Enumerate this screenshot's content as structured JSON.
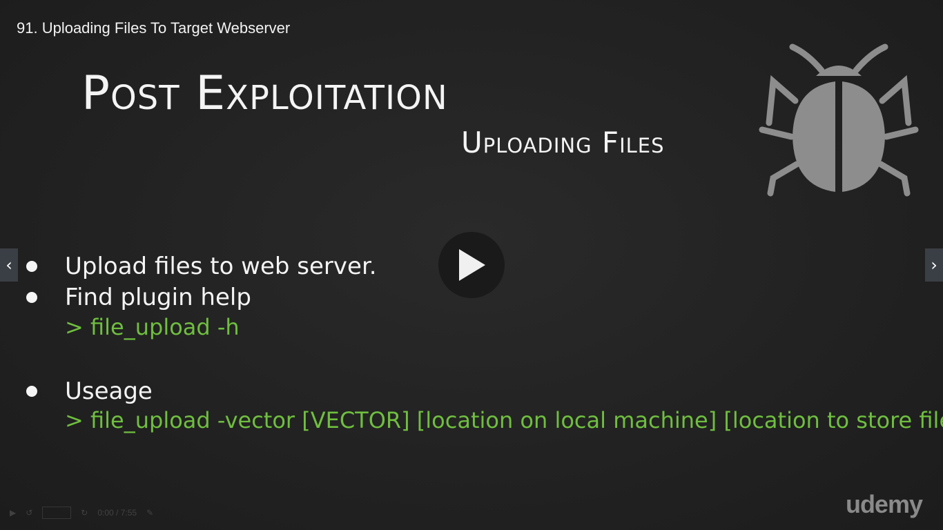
{
  "lecture": {
    "title": "91. Uploading Files To Target Webserver"
  },
  "slide": {
    "title": "Post Exploitation",
    "subtitle": "Uploading Files",
    "bullets": [
      {
        "text": "Upload files to web server."
      },
      {
        "text": "Find plugin help",
        "command": "> file_upload -h"
      },
      {
        "text": "Useage",
        "command": "> file_upload -vector [VECTOR] [location on local machine] [location to store file]"
      }
    ]
  },
  "player": {
    "prev_icon": "chevron-left-icon",
    "next_icon": "chevron-right-icon",
    "play_icon": "play-icon",
    "time_readout": "0:00 / 7:55"
  },
  "brand": {
    "name": "udemy"
  },
  "colors": {
    "accent_green": "#6fbf3f",
    "background": "#222222",
    "text": "#f4f4f4"
  }
}
